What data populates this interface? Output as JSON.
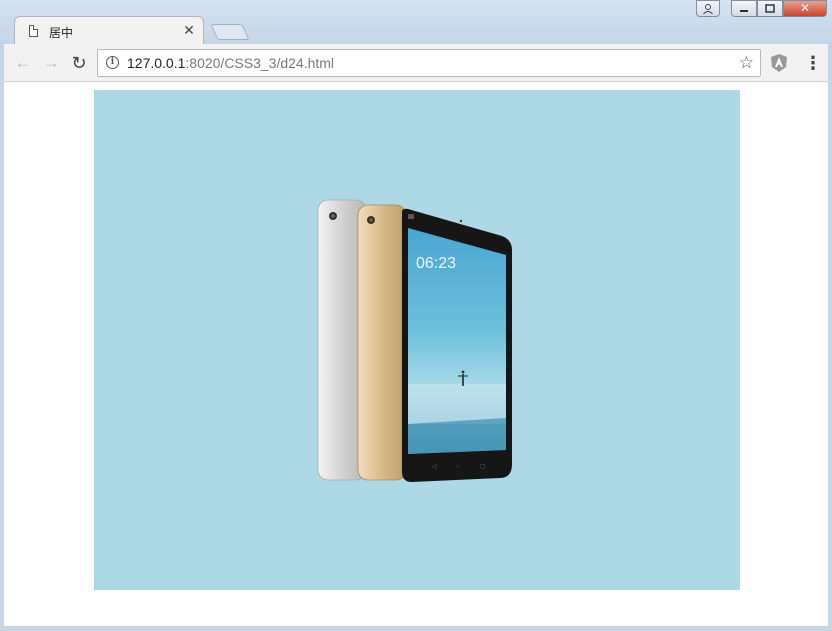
{
  "tab": {
    "title": "居中"
  },
  "address": {
    "host": "127.0.0.1",
    "rest": ":8020/CSS3_3/d24.html"
  },
  "screen": {
    "time": "06:23"
  },
  "colors": {
    "stage": "#add8e6",
    "page": "#ffffff",
    "toolbar": "#f2f2f2"
  },
  "icons": [
    "page-icon",
    "close-icon",
    "back-arrow-icon",
    "forward-arrow-icon",
    "reload-icon",
    "info-icon",
    "star-icon",
    "extension-icon",
    "menu-icon",
    "user-icon",
    "minimize-icon",
    "maximize-icon",
    "window-close-icon"
  ]
}
